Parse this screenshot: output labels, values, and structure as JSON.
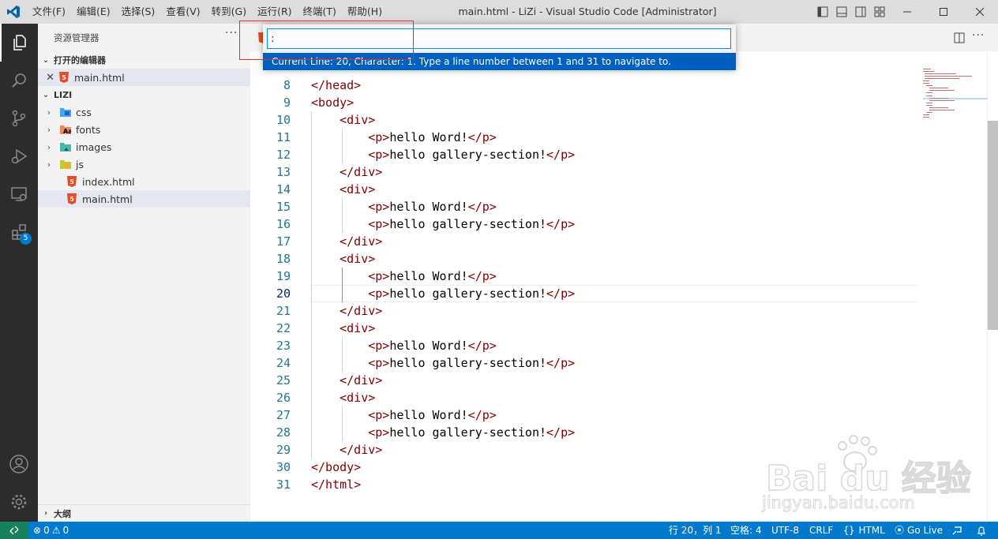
{
  "window": {
    "title": "main.html - LiZi - Visual Studio Code [Administrator]",
    "menu": [
      "文件(F)",
      "编辑(E)",
      "选择(S)",
      "查看(V)",
      "转到(G)",
      "运行(R)",
      "终端(T)",
      "帮助(H)"
    ]
  },
  "activity_bar": {
    "items": [
      "explorer-icon",
      "search-icon",
      "source-control-icon",
      "run-debug-icon",
      "remote-explorer-icon",
      "extensions-icon"
    ],
    "extensions_badge": "5",
    "bottom": [
      "accounts-icon",
      "manage-gear-icon"
    ]
  },
  "sidebar": {
    "title": "资源管理器",
    "more": "···",
    "open_editors_header": "打开的编辑器",
    "open_editors": [
      {
        "name": "main.html"
      }
    ],
    "folder_header": "LIZI",
    "tree": [
      {
        "name": "css",
        "type": "folder"
      },
      {
        "name": "fonts",
        "type": "folder"
      },
      {
        "name": "images",
        "type": "folder"
      },
      {
        "name": "js",
        "type": "folder"
      },
      {
        "name": "index.html",
        "type": "file"
      },
      {
        "name": "main.html",
        "type": "file"
      }
    ],
    "outline_header": "大纲"
  },
  "editor": {
    "current_line": 20,
    "lines": [
      {
        "n": "8",
        "text": "</head>"
      },
      {
        "n": "9",
        "text": "<body>"
      },
      {
        "n": "10",
        "text": "    <div>"
      },
      {
        "n": "11",
        "text": "        <p>hello Word!</p>"
      },
      {
        "n": "12",
        "text": "        <p>hello gallery-section!</p>"
      },
      {
        "n": "13",
        "text": "    </div>"
      },
      {
        "n": "14",
        "text": "    <div>"
      },
      {
        "n": "15",
        "text": "        <p>hello Word!</p>"
      },
      {
        "n": "16",
        "text": "        <p>hello gallery-section!</p>"
      },
      {
        "n": "17",
        "text": "    </div>"
      },
      {
        "n": "18",
        "text": "    <div>"
      },
      {
        "n": "19",
        "text": "        <p>hello Word!</p>"
      },
      {
        "n": "20",
        "text": "        <p>hello gallery-section!</p>"
      },
      {
        "n": "21",
        "text": "    </div>"
      },
      {
        "n": "22",
        "text": "    <div>"
      },
      {
        "n": "23",
        "text": "        <p>hello Word!</p>"
      },
      {
        "n": "24",
        "text": "        <p>hello gallery-section!</p>"
      },
      {
        "n": "25",
        "text": "    </div>"
      },
      {
        "n": "26",
        "text": "    <div>"
      },
      {
        "n": "27",
        "text": "        <p>hello Word!</p>"
      },
      {
        "n": "28",
        "text": "        <p>hello gallery-section!</p>"
      },
      {
        "n": "29",
        "text": "    </div>"
      },
      {
        "n": "30",
        "text": "</body>"
      },
      {
        "n": "31",
        "text": "</html>"
      }
    ]
  },
  "goto_line": {
    "value": ":",
    "message": "Current Line: 20, Character: 1. Type a line number between 1 and 31 to navigate to."
  },
  "status_bar": {
    "errors": "0",
    "warnings": "0",
    "position": "行 20，列 1",
    "spaces": "空格: 4",
    "encoding": "UTF-8",
    "eol": "CRLF",
    "language": "HTML",
    "go_live": "Go Live"
  },
  "watermark": {
    "text": "Bai du 经验",
    "url": "jingyan.baidu.com"
  },
  "colors": {
    "accent": "#007acc",
    "tag": "#800000",
    "line_number": "#237893"
  }
}
